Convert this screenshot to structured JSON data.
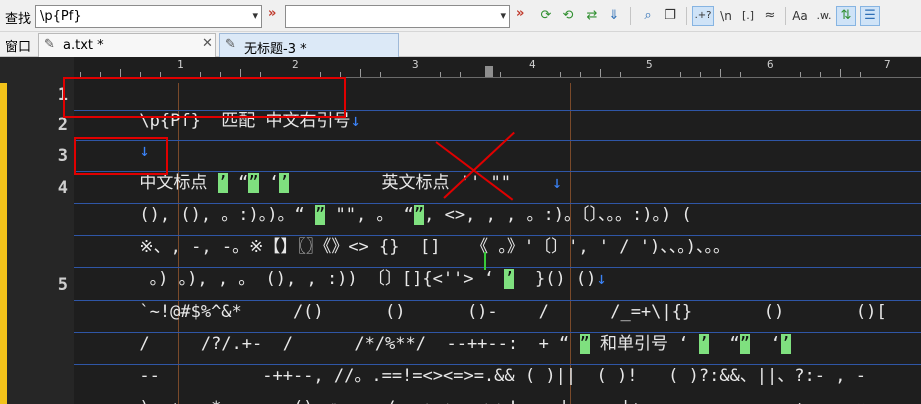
{
  "toolbar": {
    "find_label": "查找",
    "find_value": "\\p{Pf}",
    "replace_value": "",
    "toggle_labels": {
      "regex": ".+?",
      "newline": "\\n",
      "charclass": "[.]",
      "fuzzy": "≈",
      "case": "Aa",
      "word": ".w."
    }
  },
  "tabbar": {
    "window_label": "窗口",
    "tabs": [
      {
        "label": "a.txt *"
      },
      {
        "label": "无标题-3 *"
      }
    ]
  },
  "ruler": {
    "marks": [
      "1",
      "2",
      "3",
      "4",
      "5",
      "6",
      "7"
    ]
  },
  "editor": {
    "line_numbers": [
      "1",
      "2",
      "3",
      "4",
      "5"
    ],
    "lines": [
      {
        "id": "l1",
        "segments": [
          "\\p{Pf}  匹配 中文右引号",
          "↓"
        ]
      },
      {
        "id": "l2",
        "segments": [
          "↓"
        ]
      },
      {
        "id": "l3",
        "segments": [
          "中文标点 ",
          "’",
          " ",
          "“",
          "”",
          " ",
          "‘",
          "’",
          "         英文标点 '' \"\"    ",
          "↓"
        ]
      },
      {
        "id": "l4a",
        "segments": [
          "(), (), 。:)。)。“ ",
          "”",
          " \"\", 。 ",
          "“",
          "”",
          ", <>, , , 。:)。〔〕、。。:)。) ("
        ]
      },
      {
        "id": "l4b",
        "segments": [
          "※、, -, -。※【】〖〗《》<> {}  []   《 。》'〔〕', ' / ')、、。)、。。"
        ]
      },
      {
        "id": "l4c",
        "segments": [
          " 。) 。), , 。 (), , :)) 〔〕[]{<''> ‘ ",
          "’",
          "  }() ()",
          "↓"
        ]
      },
      {
        "id": "l5a",
        "segments": [
          "`~!@#$%^&*     /()      ()      ()-    /      /_=+\\|{}       ()       ()["
        ]
      },
      {
        "id": "l5b",
        "segments": [
          "/     /?/.+-  /      /*/%**/  --++--:  + “ ",
          "”",
          " 和单引号 ‘ ",
          "’",
          "  “",
          "”",
          "  ‘",
          "’"
        ]
      },
      {
        "id": "l5c",
        "segments": [
          "--          -++--, //。.==!=<><=>=.&& ( )||  ( )!   ( )?:&&、||、?:- , -"
        ]
      },
      {
        "id": "l5d",
        "segments": [
          ").=+=, *=, ....().<>    /..=>->=~<=>!--  |     |+     ; -     ; ±     ×"
        ]
      }
    ]
  }
}
